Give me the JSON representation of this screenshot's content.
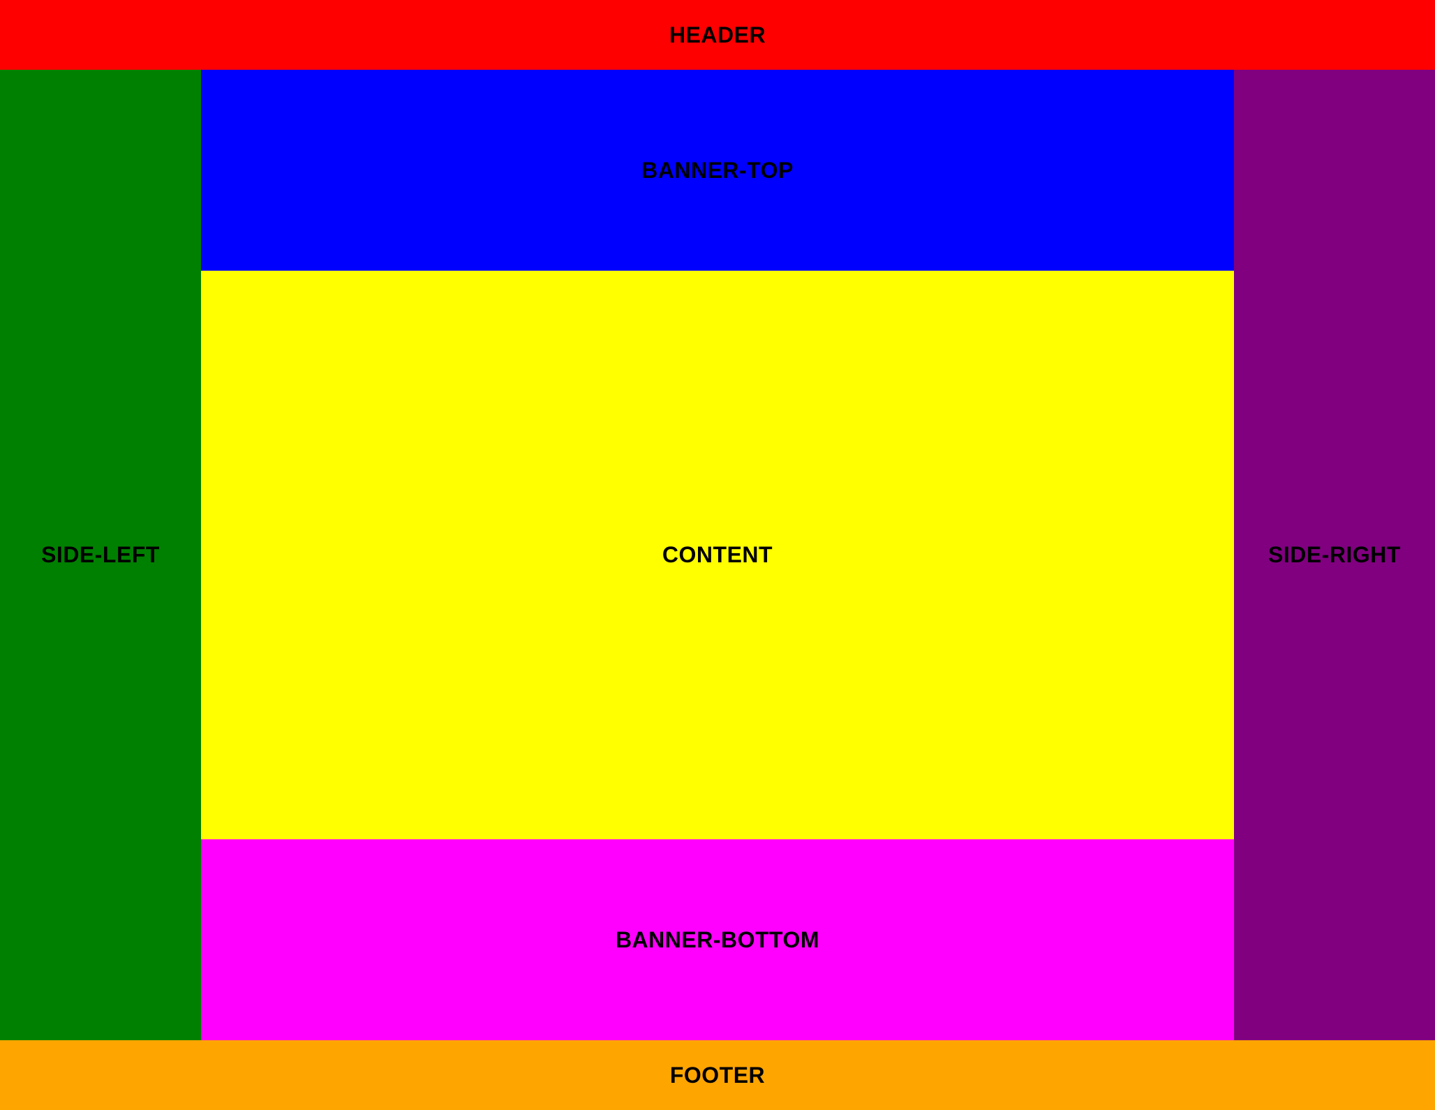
{
  "regions": {
    "header": {
      "label": "HEADER",
      "color": "#ff0000"
    },
    "side_left": {
      "label": "SIDE-LEFT",
      "color": "#008000"
    },
    "banner_top": {
      "label": "BANNER-TOP",
      "color": "#0000ff"
    },
    "content": {
      "label": "CONTENT",
      "color": "#ffff00"
    },
    "banner_bottom": {
      "label": "BANNER-BOTTOM",
      "color": "#ff00ff"
    },
    "side_right": {
      "label": "SIDE-RIGHT",
      "color": "#800080"
    },
    "footer": {
      "label": "FOOTER",
      "color": "#ffa500"
    }
  }
}
